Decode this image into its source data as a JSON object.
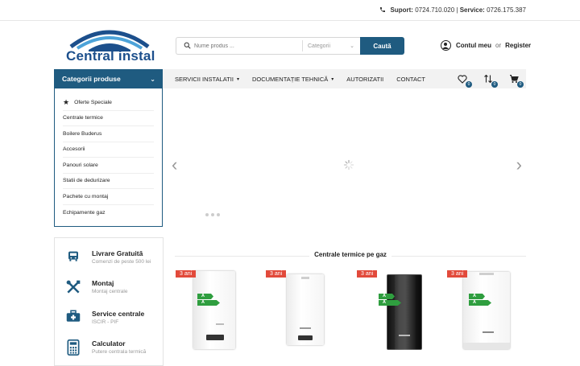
{
  "topbar": {
    "support_label": "Suport:",
    "support_phone": "0724.710.020",
    "separator": "|",
    "service_label": "Service:",
    "service_phone": "0726.175.387"
  },
  "logo": {
    "text": "Central instal"
  },
  "search": {
    "placeholder": "Nume produs ...",
    "category_placeholder": "Categorii",
    "button_label": "Caută"
  },
  "account": {
    "my_account": "Contul meu",
    "or": "or",
    "register": "Register"
  },
  "categories": {
    "header": "Categorii produse",
    "items": [
      {
        "label": "Oferte Speciale",
        "icon": "star-icon"
      },
      {
        "label": "Centrale termice"
      },
      {
        "label": "Boilere Buderus"
      },
      {
        "label": "Accesorii"
      },
      {
        "label": "Panouri solare"
      },
      {
        "label": "Statii de dedurizare"
      },
      {
        "label": "Pachete cu montaj"
      },
      {
        "label": "Echipamente gaz"
      }
    ]
  },
  "nav": {
    "items": [
      {
        "label": "SERVICII INSTALATII",
        "has_dropdown": true
      },
      {
        "label": "DOCUMENTAȚIE TEHNICĂ",
        "has_dropdown": true
      },
      {
        "label": "AUTORIZATII",
        "has_dropdown": false
      },
      {
        "label": "CONTACT",
        "has_dropdown": false
      }
    ],
    "wishlist_count": "0",
    "compare_count": "0",
    "cart_count": "0"
  },
  "features": [
    {
      "title": "Livrare Gratuită",
      "subtitle": "Comenzi de peste 500 lei",
      "icon": "truck-icon"
    },
    {
      "title": "Montaj",
      "subtitle": "Montaj centrale",
      "icon": "tools-icon"
    },
    {
      "title": "Service centrale",
      "subtitle": "ISCIR - PIF",
      "icon": "medkit-icon"
    },
    {
      "title": "Calculator",
      "subtitle": "Putere centrala termică",
      "icon": "calculator-icon"
    }
  ],
  "products_section": {
    "title": "Centrale termice pe gaz",
    "products": [
      {
        "badge": "3 ani",
        "energy": [
          "A",
          "A"
        ]
      },
      {
        "badge": "3 ani",
        "energy": []
      },
      {
        "badge": "3 ani",
        "energy": [
          "A",
          "A"
        ]
      },
      {
        "badge": "3 ani",
        "energy": [
          "A",
          "A"
        ]
      }
    ]
  },
  "colors": {
    "primary": "#1f5b80",
    "badge": "#e24a3b",
    "energy_green": "#2f9e3f"
  }
}
